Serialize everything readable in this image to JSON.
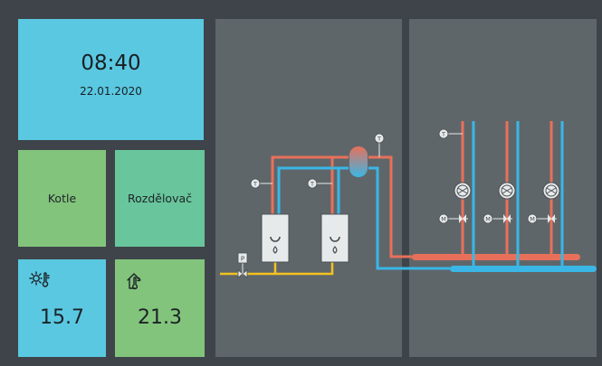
{
  "clock": {
    "time": "08:40",
    "date": "22.01.2020"
  },
  "buttons": {
    "kotle": "Kotle",
    "rozdelovac": "Rozdělovač"
  },
  "sensors": {
    "outdoor": {
      "icon": "outdoor-temperature-icon",
      "value": "15.7"
    },
    "indoor": {
      "icon": "indoor-temperature-icon",
      "value": "21.3"
    }
  },
  "schema": {
    "thermometer_label": "T",
    "mixing_valve_label": "M",
    "pressure_label": "P"
  },
  "colors": {
    "background": "#3e4449",
    "panel": "#5f666a",
    "tile_blue": "#5ac8e1",
    "tile_green": "#83c47c",
    "tile_teal": "#69c59c",
    "pipe_hot": "#e8705a",
    "pipe_cold": "#3ab7e6",
    "pipe_gas": "#f2c21f"
  }
}
